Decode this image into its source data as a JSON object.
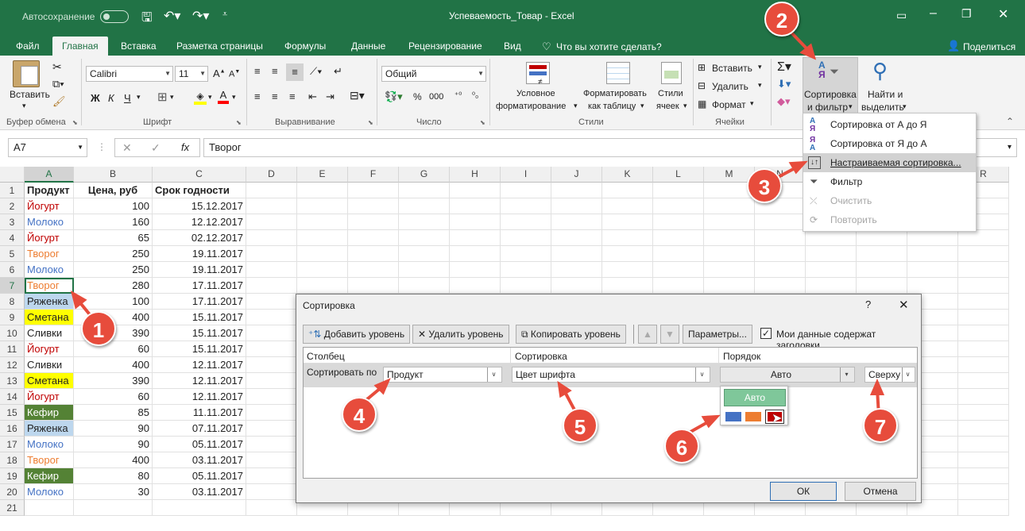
{
  "titlebar": {
    "autosave_label": "Автосохранение",
    "autosave_state": "off",
    "title": "Успеваемость_Товар  -  Excel"
  },
  "tabs": [
    {
      "label": "Файл"
    },
    {
      "label": "Главная"
    },
    {
      "label": "Вставка"
    },
    {
      "label": "Разметка страницы"
    },
    {
      "label": "Формулы"
    },
    {
      "label": "Данные"
    },
    {
      "label": "Рецензирование"
    },
    {
      "label": "Вид"
    }
  ],
  "tell_me": "Что вы хотите сделать?",
  "share_label": "Поделиться",
  "ribbon": {
    "paste_label": "Вставить",
    "clipboard_group": "Буфер обмена",
    "font_name": "Calibri",
    "font_size": "11",
    "font_group": "Шрифт",
    "bold": "Ж",
    "italic": "К",
    "underline": "Ч",
    "align_group": "Выравнивание",
    "number_format": "Общий",
    "number_group": "Число",
    "conditional_format_l1": "Условное",
    "conditional_format_l2": "форматирование",
    "format_table_l1": "Форматировать",
    "format_table_l2": "как таблицу",
    "cell_styles_l1": "Стили",
    "cell_styles_l2": "ячеек",
    "styles_group": "Стили",
    "insert_label": "Вставить",
    "delete_label": "Удалить",
    "format_label": "Формат",
    "cells_group": "Ячейки",
    "sort_filter_l1": "Сортировка",
    "sort_filter_l2": "и фильтр",
    "find_l1": "Найти и",
    "find_l2": "выделить"
  },
  "namebox": "A7",
  "formula": "Творог",
  "sort_menu": [
    {
      "label": "Сортировка от А до Я",
      "enabled": true
    },
    {
      "label": "Сортировка от Я до А",
      "enabled": true
    },
    {
      "label": "Настраиваемая сортировка...",
      "enabled": true
    },
    {
      "label": "Фильтр",
      "enabled": true
    },
    {
      "label": "Очистить",
      "enabled": false
    },
    {
      "label": "Повторить",
      "enabled": false
    }
  ],
  "columns": [
    "A",
    "B",
    "C",
    "D",
    "E",
    "F",
    "G",
    "H",
    "I",
    "J",
    "K",
    "L",
    "M",
    "N",
    "O",
    "P",
    "Q",
    "R"
  ],
  "sheet": {
    "headers": [
      "Продукт",
      "Цена, руб",
      "Срок годности"
    ],
    "rows": [
      [
        "Йогурт",
        "100",
        "15.12.2017"
      ],
      [
        "Молоко",
        "160",
        "12.12.2017"
      ],
      [
        "Йогурт",
        "65",
        "02.12.2017"
      ],
      [
        "Творог",
        "250",
        "19.11.2017"
      ],
      [
        "Молоко",
        "250",
        "19.11.2017"
      ],
      [
        "Творог",
        "280",
        "17.11.2017"
      ],
      [
        "Ряженка",
        "100",
        "17.11.2017"
      ],
      [
        "Сметана",
        "400",
        "15.11.2017"
      ],
      [
        "Сливки",
        "390",
        "15.11.2017"
      ],
      [
        "Йогурт",
        "60",
        "15.11.2017"
      ],
      [
        "Сливки",
        "400",
        "12.11.2017"
      ],
      [
        "Сметана",
        "390",
        "12.11.2017"
      ],
      [
        "Йогурт",
        "60",
        "12.11.2017"
      ],
      [
        "Кефир",
        "85",
        "11.11.2017"
      ],
      [
        "Ряженка",
        "90",
        "07.11.2017"
      ],
      [
        "Молоко",
        "90",
        "05.11.2017"
      ],
      [
        "Творог",
        "400",
        "03.11.2017"
      ],
      [
        "Кефир",
        "80",
        "05.11.2017"
      ],
      [
        "Молоко",
        "30",
        "03.11.2017"
      ]
    ]
  },
  "colors": {
    "excel_green": "#217346",
    "yogurt_font": "#c00000",
    "milk_font": "#4472c4",
    "tvorog_font": "#ed7d31",
    "ryazhenka_fill": "#bdd7ee",
    "smetana_fill": "#ffff00",
    "kefir_fill": "#548235",
    "kefir_font": "#ffffff",
    "badge": "#e74c3c"
  },
  "dialog": {
    "title": "Сортировка",
    "help": "?",
    "add_level": "Добавить уровень",
    "delete_level": "Удалить уровень",
    "copy_level": "Копировать уровень",
    "params": "Параметры...",
    "has_headers_label": "Мои данные содержат заголовки",
    "has_headers_checked": true,
    "col_column": "Столбец",
    "col_sort": "Сортировка",
    "col_order": "Порядок",
    "sort_by_label": "Сортировать по",
    "sort_by_value": "Продукт",
    "sort_on_value": "Цвет шрифта",
    "order_value": "Авто",
    "position_value": "Сверху",
    "swatch_auto": "Авто",
    "ok": "ОК",
    "cancel": "Отмена"
  },
  "badges": [
    "1",
    "2",
    "3",
    "4",
    "5",
    "6",
    "7"
  ]
}
